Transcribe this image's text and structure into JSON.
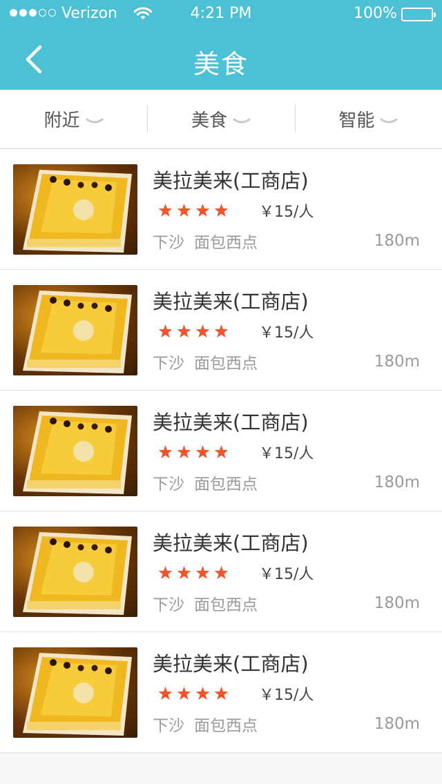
{
  "status_bar": {
    "carrier": "Verizon",
    "time": "4:21 PM",
    "battery": "100%"
  },
  "nav": {
    "title": "美食"
  },
  "filters": [
    {
      "label": "附近"
    },
    {
      "label": "美食"
    },
    {
      "label": "智能"
    }
  ],
  "items": [
    {
      "name": "美拉美来(工商店)",
      "rating": 4,
      "price": "￥15/人",
      "area": "下沙",
      "category": "面包西点",
      "distance": "180m"
    },
    {
      "name": "美拉美来(工商店)",
      "rating": 4,
      "price": "￥15/人",
      "area": "下沙",
      "category": "面包西点",
      "distance": "180m"
    },
    {
      "name": "美拉美来(工商店)",
      "rating": 4,
      "price": "￥15/人",
      "area": "下沙",
      "category": "面包西点",
      "distance": "180m"
    },
    {
      "name": "美拉美来(工商店)",
      "rating": 4,
      "price": "￥15/人",
      "area": "下沙",
      "category": "面包西点",
      "distance": "180m"
    },
    {
      "name": "美拉美来(工商店)",
      "rating": 4,
      "price": "￥15/人",
      "area": "下沙",
      "category": "面包西点",
      "distance": "180m"
    }
  ],
  "colors": {
    "header": "#4cc0d4",
    "star": "#f2552c"
  }
}
